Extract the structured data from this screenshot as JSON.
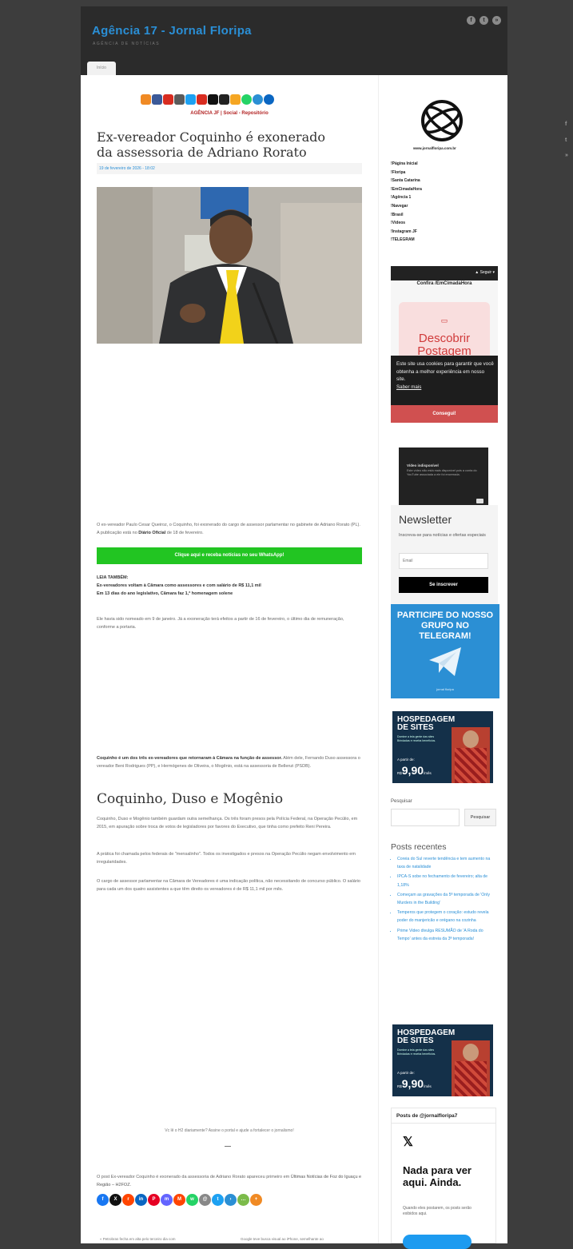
{
  "site": {
    "title": "Agência 17 - Jornal Floripa",
    "tagline": "AGÊNCIA DE NOTÍCIAS",
    "home_tab": "Início"
  },
  "colors": {
    "header_bg": "#2b2b2b",
    "page_bg": "#3d3d3d",
    "link": "#2a8fd6",
    "whatsapp": "#22c522",
    "telegram": "#2b8fd4",
    "cookie_accept": "#d05050"
  },
  "header_social": [
    "facebook-icon",
    "twitter-icon",
    "rss-icon"
  ],
  "article": {
    "top_links": "AGÊNCIA JF | Social - Repositório",
    "title": "Ex-vereador Coquinho é exonerado da assessoria de Adriano Rorato",
    "date": "19 de fevereiro de 2026 - 18:02",
    "p1_a": "O ex-vereador Paulo Cesar Queiroz, o Coquinho, foi exonerado do cargo de assessor parlamentar no gabinete de Adriano Rorato (PL). A publicação está no ",
    "p1_b": "Diário Oficial",
    "p1_c": " de 18 de fevereiro.",
    "whatsapp_cta": "Clique aqui e receba notícias no seu WhatsApp!",
    "leia_label": "LEIA TAMBÉM:",
    "leia_1": "Ex-vereadores voltam à Câmara como assessores e com salário de R$ 11,1 mil",
    "leia_2": "Em 13 dias do ano legislativo, Câmara faz 1,ª homenagem solene",
    "p2": "Ele havia sido nomeado em 9 de janeiro. Já a exoneração terá efeitos a partir de 16 de fevereiro, o último dia de remuneração, conforme a portaria.",
    "p3_bold": "Coquinho é um dos três ex-vereadores que retornaram à Câmara na função de assessor.",
    "p3_rest": " Além dele, Fernando Duso assessora o vereador Beni Rodrigues (PP), e Hermógenes de Oliveira, o Mogênio, está na assessoria de Bellenzi (PSDB).",
    "subtitle": "Coquinho, Duso e Mogênio",
    "p4": "Coquinho, Duso e Mogênio também guardam outra semelhança. Os três foram presos pela Polícia Federal, na Operação Pecúlio, em 2015, em apuração sobre troca de votos de legisladores por favores do Executivo, que tinha como prefeito Reni Pereira.",
    "p5": "A prática foi chamada pelos federais de \"mensalinho\". Todos os investigados e presos na Operação Pecúlio negam envolvimento em irregularidades.",
    "p6": "O cargo de assessor parlamentar na Câmara de Vereadores é uma indicação política, não necessitando de concurso público. O salário para cada um dos quatro assistentes a que têm direito os vereadores é de R$ 11,1 mil por mês.",
    "support": "Vc lê o H2 diariamente? Assine o portal e ajude a fortalecer o jornalismo!",
    "source_a": "O post Ex-vereador Coquinho é exonerado da assessoria de Adriano Rorato apareceu primeiro em ",
    "source_link": "Últimas Notícias de Foz do Iguaçu e Região – H2FOZ",
    "source_c": ".",
    "prev": "« Petrobras fecha em alta pelo terceiro dia com",
    "next": "Google teve busca visual ao iPhone, semelhante ao"
  },
  "sidebar": {
    "logo_caption": "www.jornalfloripa.com.br",
    "links": [
      "!Página Inicial",
      "!Floripa",
      "!Santa Catarina",
      "!EmCimadaHora",
      "!Agência 1",
      "!Navegar",
      "!Brasil",
      "!Vídeos",
      "!Instagram JF",
      "!TELEGRAM"
    ],
    "widget_follow": "Seguir",
    "widget_title": "Confira /EmCimadaHora",
    "widget_discover": "Descobrir Postagem",
    "cookie_text": "Este site usa cookies para garantir que você obtenha a melhor experiência em nosso site.",
    "cookie_more": "Saber mais",
    "cookie_accept": "Consegui!",
    "video_title": "Vídeo indisponível",
    "video_text": "Este vídeo não está mais disponível pois a conta do YouTube associada a ele foi encerrada.",
    "newsletter_title": "Newsletter",
    "newsletter_desc": "Inscreva-se para notícias e ofertas especiais",
    "email_placeholder": "Email",
    "subscribe": "Se inscrever",
    "telegram_text": "PARTICIPE DO NOSSO GRUPO NO TELEGRAM!",
    "telegram_site": "jornal floripa",
    "hosting_title": "HOSPEDAGEM DE SITES",
    "hosting_desc": "Domine a tela gente das sites Brindadas e receba benefícios.",
    "hosting_from": "A partir de:",
    "hosting_price": "9,90",
    "hosting_currency": "R$",
    "hosting_period": "/mês",
    "search_label": "Pesquisar",
    "search_button": "Pesquisar",
    "recent_title": "Posts recentes",
    "recent": [
      "Coreia do Sul reverte tendência e tem aumento na taxa de natalidade",
      "IPCA-S sobe no fechamento de fevereiro; alta de 1,18%",
      "Começam as gravações da 5ª temporada de 'Only Murders in the Building'",
      "Temperos que protegem o coração: estudo revela poder do manjericão e orégano na cozinha",
      "Prime Video divulga RESUMÃO de 'A Roda do Tempo' antes da estreia da 3ª temporada!"
    ],
    "twitter_title": "Posts de @jornalfloripa7",
    "twitter_empty": "Nada para ver aqui. Ainda.",
    "twitter_sub": "Quando eles postarem, os posts serão exibidos aqui."
  }
}
